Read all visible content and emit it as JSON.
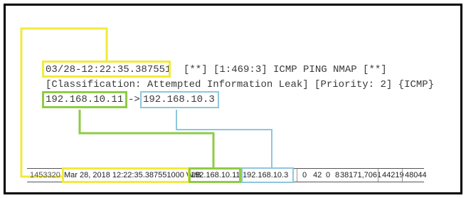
{
  "log": {
    "timestamp": "03/28-12:22:35.387551",
    "line1_rest": "[**] [1:469:3] ICMP PING NMAP [**]",
    "line2": "[Classification: Attempted Information Leak] [Priority: 2] {ICMP}",
    "src_ip": "192.168.10.11",
    "arrow": "->",
    "dst_ip": "192.168.10.3"
  },
  "csv_row": {
    "cut_value": "1453320",
    "timestamp": "Mar 28, 2018 12:22:35.387551000 WIB",
    "src_ip": "192.168.10.11",
    "dst_ip": "192.168.10.3",
    "values": [
      "0",
      "42",
      "0",
      "8",
      "38171,7061",
      "44219",
      "48044"
    ]
  },
  "colors": {
    "timestamp_highlight": "#f2ea3c",
    "source_highlight": "#8fcb45",
    "destination_highlight": "#8ec6dd"
  }
}
